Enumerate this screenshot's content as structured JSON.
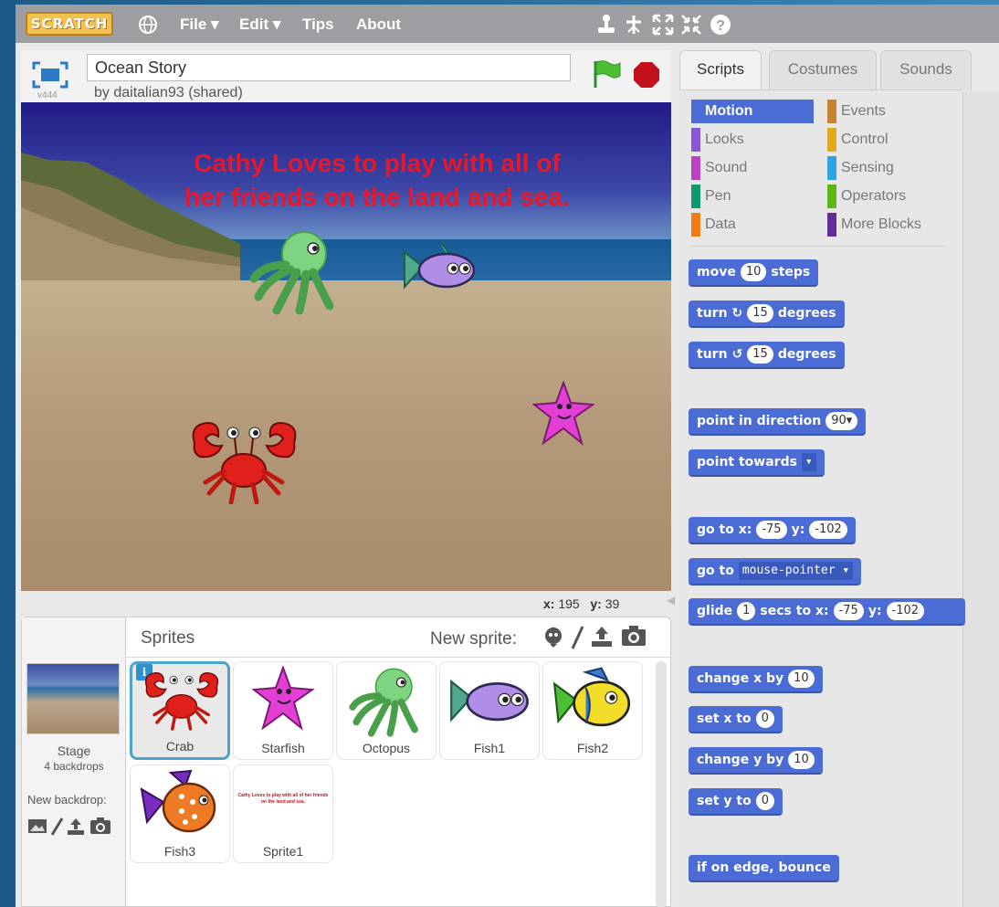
{
  "menubar": {
    "logo": "SCRATCH",
    "menus": [
      {
        "label": "File ▾"
      },
      {
        "label": "Edit ▾"
      },
      {
        "label": "Tips"
      },
      {
        "label": "About"
      }
    ]
  },
  "project": {
    "title": "Ocean Story",
    "author": "by daitalian93 (shared)",
    "version": "v444"
  },
  "stage": {
    "text_line1": "Cathy Loves to play with all of",
    "text_line2": "her friends on the land and sea."
  },
  "coords": {
    "x_label": "x:",
    "x_value": "195",
    "y_label": "y:",
    "y_value": "39"
  },
  "sprites_pane": {
    "title": "Sprites",
    "new_sprite_label": "New sprite:",
    "stage_label": "Stage",
    "backdrops": "4 backdrops",
    "new_backdrop_label": "New backdrop:",
    "info_badge": "i",
    "sprites": [
      {
        "name": "Crab"
      },
      {
        "name": "Starfish"
      },
      {
        "name": "Octopus"
      },
      {
        "name": "Fish1"
      },
      {
        "name": "Fish2"
      },
      {
        "name": "Fish3"
      },
      {
        "name": "Sprite1"
      }
    ],
    "sprite1_preview_text": "Cathy Loves to play with all of her friends on the land and sea."
  },
  "tabs": [
    {
      "label": "Scripts"
    },
    {
      "label": "Costumes"
    },
    {
      "label": "Sounds"
    }
  ],
  "categories": [
    {
      "label": "Motion",
      "color": "#4a6cd4"
    },
    {
      "label": "Looks",
      "color": "#8a55d7"
    },
    {
      "label": "Sound",
      "color": "#bb42c3"
    },
    {
      "label": "Pen",
      "color": "#0e9a6c"
    },
    {
      "label": "Data",
      "color": "#ee7d16"
    },
    {
      "label": "Events",
      "color": "#c88330"
    },
    {
      "label": "Control",
      "color": "#e1a91a"
    },
    {
      "label": "Sensing",
      "color": "#2ca5e2"
    },
    {
      "label": "Operators",
      "color": "#5cb712"
    },
    {
      "label": "More Blocks",
      "color": "#632d99"
    }
  ],
  "blocks": {
    "move": {
      "pre": "move",
      "num": "10",
      "post": "steps"
    },
    "turn_cw": {
      "pre": "turn",
      "icon": "↻",
      "num": "15",
      "post": "degrees"
    },
    "turn_ccw": {
      "pre": "turn",
      "icon": "↺",
      "num": "15",
      "post": "degrees"
    },
    "point_dir": {
      "pre": "point in direction",
      "num": "90▾"
    },
    "point_towards": {
      "pre": "point towards",
      "drop": "▾"
    },
    "goto_xy": {
      "pre": "go to x:",
      "x": "-75",
      "mid": "y:",
      "y": "-102"
    },
    "goto": {
      "pre": "go to",
      "drop": "mouse-pointer ▾"
    },
    "glide": {
      "pre": "glide",
      "secs": "1",
      "mid1": "secs to x:",
      "x": "-75",
      "mid2": "y:",
      "y": "-102"
    },
    "change_x": {
      "pre": "change x by",
      "num": "10"
    },
    "set_x": {
      "pre": "set x to",
      "num": "0"
    },
    "change_y": {
      "pre": "change y by",
      "num": "10"
    },
    "set_y": {
      "pre": "set y to",
      "num": "0"
    },
    "bounce": {
      "pre": "if on edge, bounce"
    }
  }
}
